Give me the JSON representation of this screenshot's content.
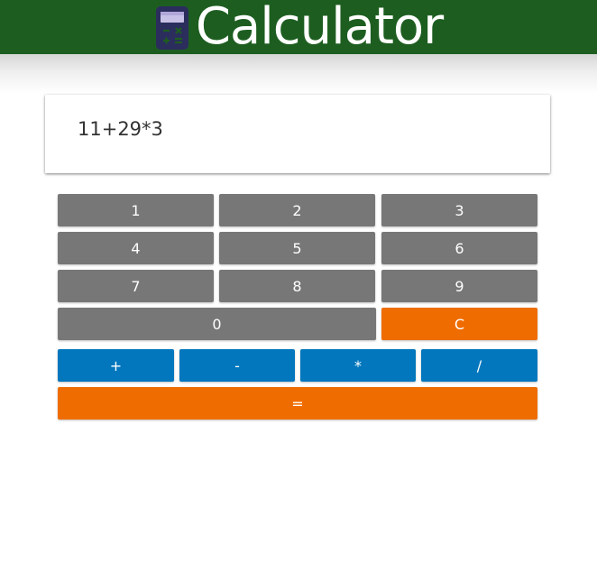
{
  "header": {
    "title": "Calculator",
    "icon": "calculator-icon",
    "background_color": "#1d5e20"
  },
  "display": {
    "expression": "11+29*3"
  },
  "keypad": {
    "digits": [
      "1",
      "2",
      "3",
      "4",
      "5",
      "6",
      "7",
      "8",
      "9",
      "0"
    ],
    "clear_label": "C",
    "operators": [
      "+",
      "-",
      "*",
      "/"
    ],
    "equals_label": "="
  },
  "colors": {
    "digit_button": "#777777",
    "operator_button": "#0277bd",
    "clear_button": "#ef6c00",
    "equals_button": "#ef6c00"
  }
}
